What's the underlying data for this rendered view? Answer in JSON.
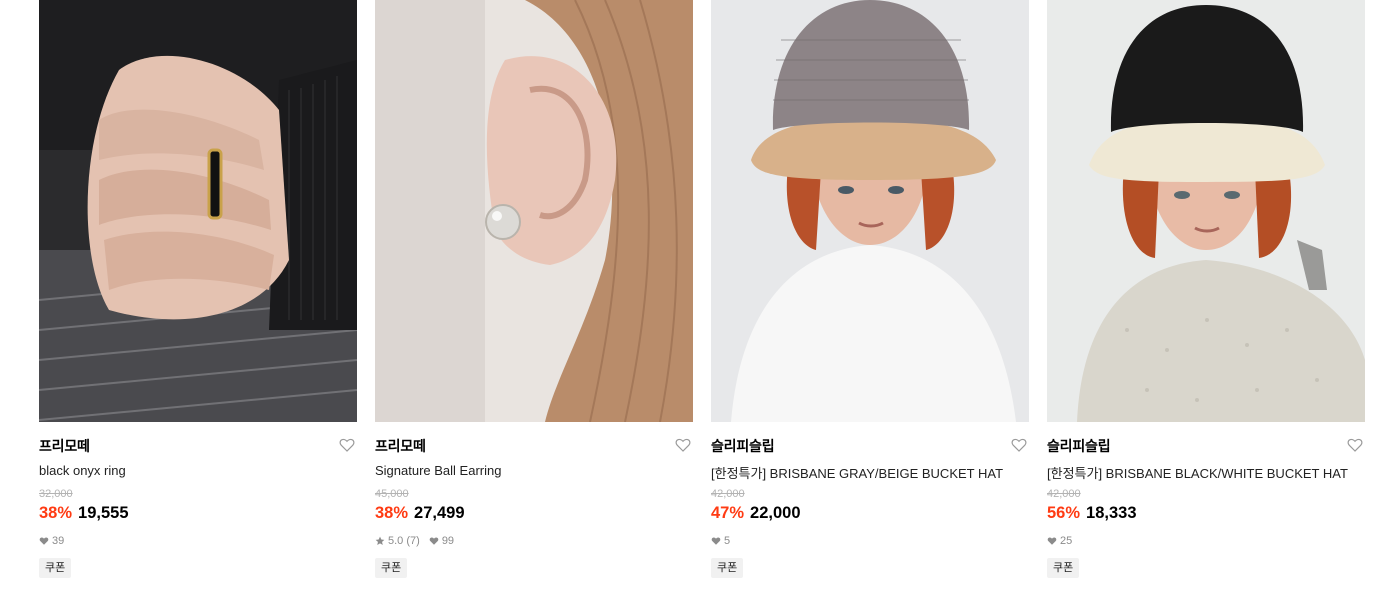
{
  "products": [
    {
      "brand": "프리모떼",
      "name": "black onyx ring",
      "original_price": "32,000",
      "discount": "38%",
      "price": "19,555",
      "likes": "39",
      "rating": "",
      "reviews": "",
      "coupon": "쿠폰",
      "image": "ring-on-hand-photo"
    },
    {
      "brand": "프리모떼",
      "name": "Signature Ball Earring",
      "original_price": "45,000",
      "discount": "38%",
      "price": "27,499",
      "likes": "99",
      "rating": "5.0",
      "reviews": "(7)",
      "coupon": "쿠폰",
      "image": "earring-on-ear-photo"
    },
    {
      "brand": "슬리피슬립",
      "name": "[한정특가] BRISBANE GRAY/BEIGE BUCKET HAT",
      "original_price": "42,000",
      "discount": "47%",
      "price": "22,000",
      "likes": "5",
      "rating": "",
      "reviews": "",
      "coupon": "쿠폰",
      "image": "gray-beige-bucket-hat-photo"
    },
    {
      "brand": "슬리피슬립",
      "name": "[한정특가] BRISBANE BLACK/WHITE BUCKET HAT",
      "original_price": "42,000",
      "discount": "56%",
      "price": "18,333",
      "likes": "25",
      "rating": "",
      "reviews": "",
      "coupon": "쿠폰",
      "image": "black-white-bucket-hat-photo"
    }
  ],
  "colors": {
    "discount": "#ff3b13",
    "muted": "#8b8b8b",
    "strike": "#b3b3b3",
    "coupon_bg": "#f1f1f1"
  }
}
